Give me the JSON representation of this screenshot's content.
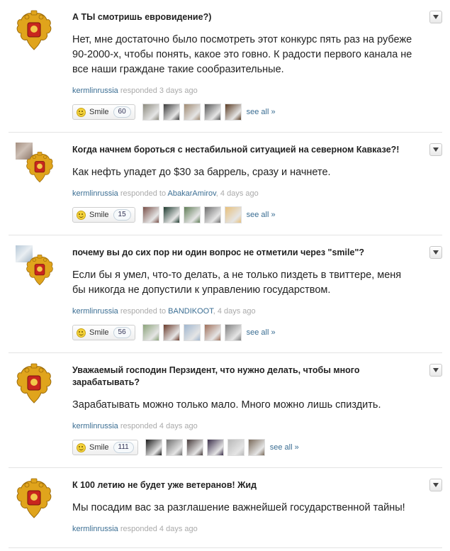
{
  "feed": {
    "posts": [
      {
        "question": "А ТЫ смотришь евровидение?)",
        "answer": "Нет, мне достаточно было посмотреть этот конкурс пять раз на рубеже 90-2000-х, чтобы понять, какое это говно. К радости первого канала не все наши граждане такие сообразительные.",
        "user": "kermlinrussia",
        "responded": "responded",
        "target": "",
        "suffix": "3 days ago",
        "smile_label": "Smile",
        "smile_count": "60",
        "see_all": "see all »",
        "asker_avatar": false,
        "thumb_colors": [
          "#8c8a7e",
          "#3a3a3a",
          "#a08a72",
          "#555",
          "#5a3b22"
        ]
      },
      {
        "question": "Когда начнем бороться с нестабильной ситуацией на северном Кавказе?!",
        "answer": "Как нефть упадет до $30 за баррель, сразу и начнете.",
        "user": "kermlinrussia",
        "responded": "responded to",
        "target": "AbakarAmirov",
        "suffix": ", 4 days ago",
        "smile_label": "Smile",
        "smile_count": "15",
        "see_all": "see all »",
        "asker_avatar": true,
        "thumb_colors": [
          "#7a5048",
          "#1d3a2e",
          "#5f7d56",
          "#6d6d6d",
          "#e8c07a"
        ]
      },
      {
        "question": "почему вы до сих пор ни один вопрос не отметили через \"smile\"?",
        "answer": "Если бы я умел, что-то делать, а не только пиздеть в твиттере, меня бы никогда не допустили к управлению государством.",
        "user": "kermlinrussia",
        "responded": "responded to",
        "target": "BANDIKOOT",
        "suffix": ", 4 days ago",
        "smile_label": "Smile",
        "smile_count": "56",
        "see_all": "see all »",
        "asker_avatar": true,
        "thumb_colors": [
          "#8ba37a",
          "#6a3a2a",
          "#9fb6cf",
          "#a0705a",
          "#7f7f7f"
        ]
      },
      {
        "question": "Уважаемый господин Перзидент, что нужно делать, чтобы много зарабатывать?",
        "answer": "Зарабатывать можно только мало. Много можно лишь спиздить.",
        "user": "kermlinrussia",
        "responded": "responded",
        "target": "",
        "suffix": "4 days ago",
        "smile_label": "Smile",
        "smile_count": "111",
        "see_all": "see all »",
        "asker_avatar": false,
        "thumb_colors": [
          "#1a1a1a",
          "#6f6f6f",
          "#463a3a",
          "#3a2e4a",
          "#b9b9b9",
          "#7a6a5a"
        ]
      },
      {
        "question": "К 100 летию не будет уже ветеранов! Жид",
        "answer": "Мы посадим вас за разглашение важнейшей государственной тайны!",
        "user": "kermlinrussia",
        "responded": "responded",
        "target": "",
        "suffix": "4 days ago",
        "smile_label": "",
        "smile_count": "",
        "see_all": "",
        "asker_avatar": false,
        "thumb_colors": []
      }
    ]
  }
}
